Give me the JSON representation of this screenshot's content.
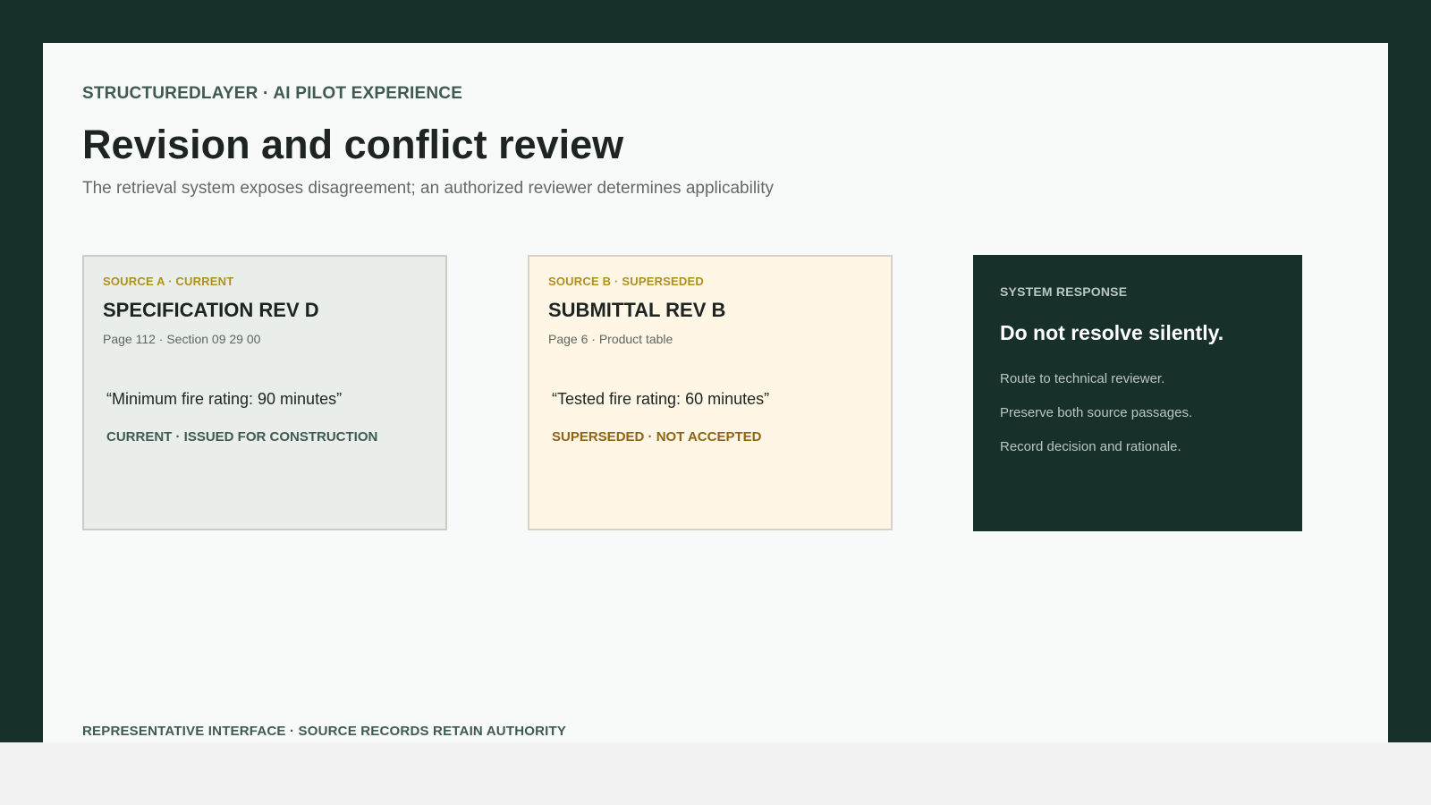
{
  "header": {
    "eyebrow": "STRUCTUREDLAYER · AI PILOT EXPERIENCE",
    "title": "Revision and conflict review",
    "subtitle": "The retrieval system exposes disagreement; an authorized reviewer determines applicability"
  },
  "sources": [
    {
      "tag": "SOURCE A · CURRENT",
      "document": "SPECIFICATION REV D",
      "location": "Page 112 · Section 09 29 00",
      "quote": "“Minimum fire rating: 90 minutes”",
      "status": "CURRENT · ISSUED FOR CONSTRUCTION"
    },
    {
      "tag": "SOURCE B · SUPERSEDED",
      "document": "SUBMITTAL REV B",
      "location": "Page 6 · Product table",
      "quote": "“Tested fire rating: 60 minutes”",
      "status": "SUPERSEDED · NOT ACCEPTED"
    }
  ],
  "response": {
    "tag": "SYSTEM RESPONSE",
    "headline": "Do not resolve silently.",
    "items": [
      "Route to technical reviewer.",
      "Preserve both source passages.",
      "Record decision and rationale."
    ]
  },
  "footer": "REPRESENTATIVE INTERFACE · SOURCE RECORDS RETAIN AUTHORITY",
  "colors": {
    "frame": "#17302b",
    "slide": "#f8faf9",
    "current_card": "#eaeeeb",
    "superseded_card": "#fff6e6",
    "accent_gold": "#b08f1f",
    "superseded_status": "#8f6414"
  }
}
